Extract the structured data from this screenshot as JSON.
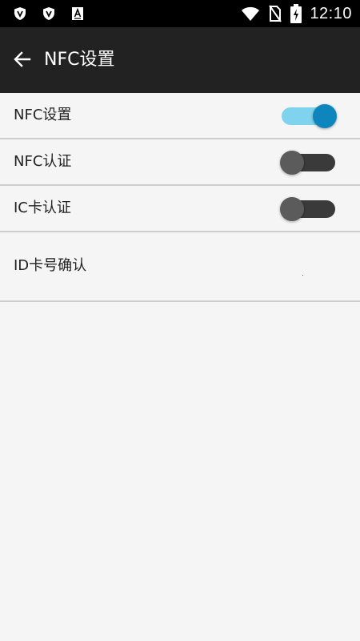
{
  "status_bar": {
    "time": "12:10",
    "left_icons": [
      "shield-icon",
      "shield-icon",
      "text-a-icon"
    ],
    "right_icons": [
      "wifi-icon",
      "no-sim-icon",
      "battery-charging-icon"
    ]
  },
  "toolbar": {
    "back_icon": "arrow-left-icon",
    "title": "NFC设置"
  },
  "settings": [
    {
      "label": "NFC设置",
      "type": "switch",
      "checked": true
    },
    {
      "label": "NFC认证",
      "type": "switch",
      "checked": false
    },
    {
      "label": "IC卡认证",
      "type": "switch",
      "checked": false
    },
    {
      "label": "ID卡号确认",
      "type": "item"
    }
  ],
  "colors": {
    "status_bar": "#000000",
    "toolbar": "#222222",
    "background": "#f5f5f5",
    "divider": "#cdcdcd",
    "switch_on_track": "#7fd3ee",
    "switch_on_thumb": "#0e86bd",
    "switch_off_track": "#3a3a3a",
    "switch_off_thumb": "#5b5b5b"
  }
}
